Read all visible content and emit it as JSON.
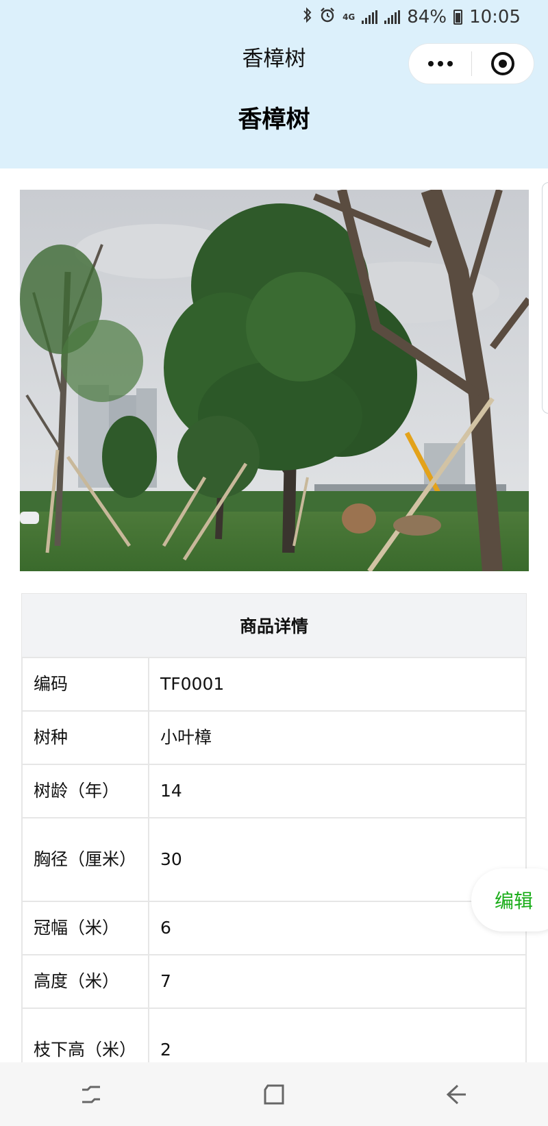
{
  "status_bar": {
    "battery": "84%",
    "time": "10:05",
    "network_label": "4G",
    "icons": [
      "bluetooth-icon",
      "alarm-icon",
      "signal-icon",
      "battery-icon"
    ]
  },
  "nav": {
    "title": "香樟树",
    "more_icon": "more-dots-icon",
    "close_icon": "target-circle-icon"
  },
  "page": {
    "title": "香樟树",
    "photo_icon": "tree-photo"
  },
  "detail": {
    "header": "商品详情",
    "rows": [
      {
        "label": "编码",
        "value": "TF0001"
      },
      {
        "label": "树种",
        "value": "小叶樟"
      },
      {
        "label": "树龄（年）",
        "value": "14"
      },
      {
        "label": "胸径（厘米）",
        "value": "30"
      },
      {
        "label": "冠幅（米）",
        "value": "6"
      },
      {
        "label": "高度（米）",
        "value": "7"
      },
      {
        "label": "枝下高（米）",
        "value": "2"
      }
    ]
  },
  "edit_button": {
    "label": "编辑",
    "color": "#1aad19"
  },
  "system_nav": {
    "icons": [
      "recents-icon",
      "home-icon",
      "back-icon"
    ]
  },
  "colors": {
    "header_bg": "#dcf0fb",
    "accent": "#1aad19"
  }
}
